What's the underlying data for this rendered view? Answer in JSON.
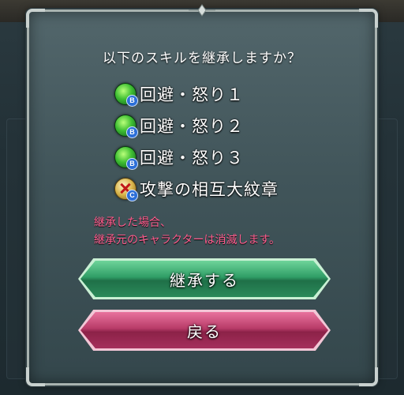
{
  "dialog": {
    "question": "以下のスキルを継承しますか？",
    "skills": [
      {
        "name": "回避・怒り１",
        "badge": "B",
        "icon": "green-orb-icon"
      },
      {
        "name": "回避・怒り２",
        "badge": "B",
        "icon": "green-orb-icon"
      },
      {
        "name": "回避・怒り３",
        "badge": "B",
        "icon": "green-orb-icon"
      },
      {
        "name": "攻撃の相互大紋章",
        "badge": "C",
        "icon": "crossed-swords-orb-icon"
      }
    ],
    "warning_line1": "継承した場合、",
    "warning_line2": "継承元のキャラクターは消滅します。",
    "confirm_label": "継承する",
    "back_label": "戻る"
  },
  "colors": {
    "warning": "#ff5d8e",
    "confirm_button": "#2f9e66",
    "back_button": "#b83b68",
    "skill_badge": "#2c6fd8"
  }
}
